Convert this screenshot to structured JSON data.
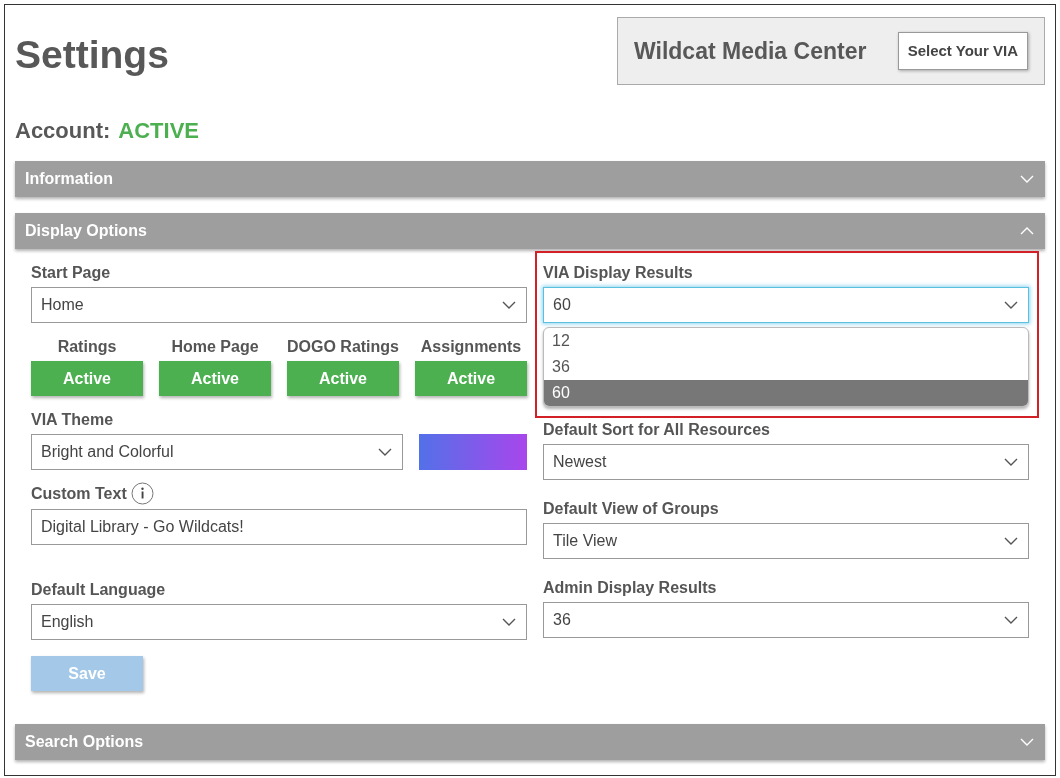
{
  "page": {
    "title": "Settings"
  },
  "district": {
    "name": "Wildcat Media Center",
    "button": "Select Your VIA"
  },
  "account": {
    "label": "Account:",
    "status": "ACTIVE"
  },
  "sections": [
    {
      "title": "Information",
      "expanded": false
    },
    {
      "title": "Display Options",
      "expanded": true,
      "content": {
        "start_page": {
          "label": "Start Page",
          "value": "Home"
        },
        "toggles": [
          {
            "label": "Ratings",
            "button": "Active",
            "on": true
          },
          {
            "label": "Home Page",
            "button": "Active",
            "on": true
          },
          {
            "label": "DOGO Ratings",
            "button": "Active",
            "on": true
          },
          {
            "label": "Assignments",
            "button": "Active",
            "on": true
          }
        ],
        "theme": {
          "label": "VIA Theme",
          "value": "Bright and Colorful"
        },
        "custom_text": {
          "label": "Custom Text",
          "value": "Digital Library - Go Wildcats!"
        },
        "language": {
          "label": "Default Language",
          "value": "English"
        },
        "save": {
          "label": "Save",
          "disabled": true
        },
        "display_results": {
          "label": "VIA Display Results",
          "value": "60",
          "expanded": true,
          "options": [
            {
              "label": "12",
              "selected": false
            },
            {
              "label": "36",
              "selected": false
            },
            {
              "label": "60",
              "selected": true
            }
          ]
        },
        "sort": {
          "label": "Default Sort for All Resources",
          "value": "Newest"
        },
        "group_view": {
          "label": "Default View of Groups",
          "value": "Tile View"
        },
        "admin_results": {
          "label": "Admin Display Results",
          "value": "36"
        }
      }
    },
    {
      "title": "Search Options",
      "expanded": false
    }
  ]
}
